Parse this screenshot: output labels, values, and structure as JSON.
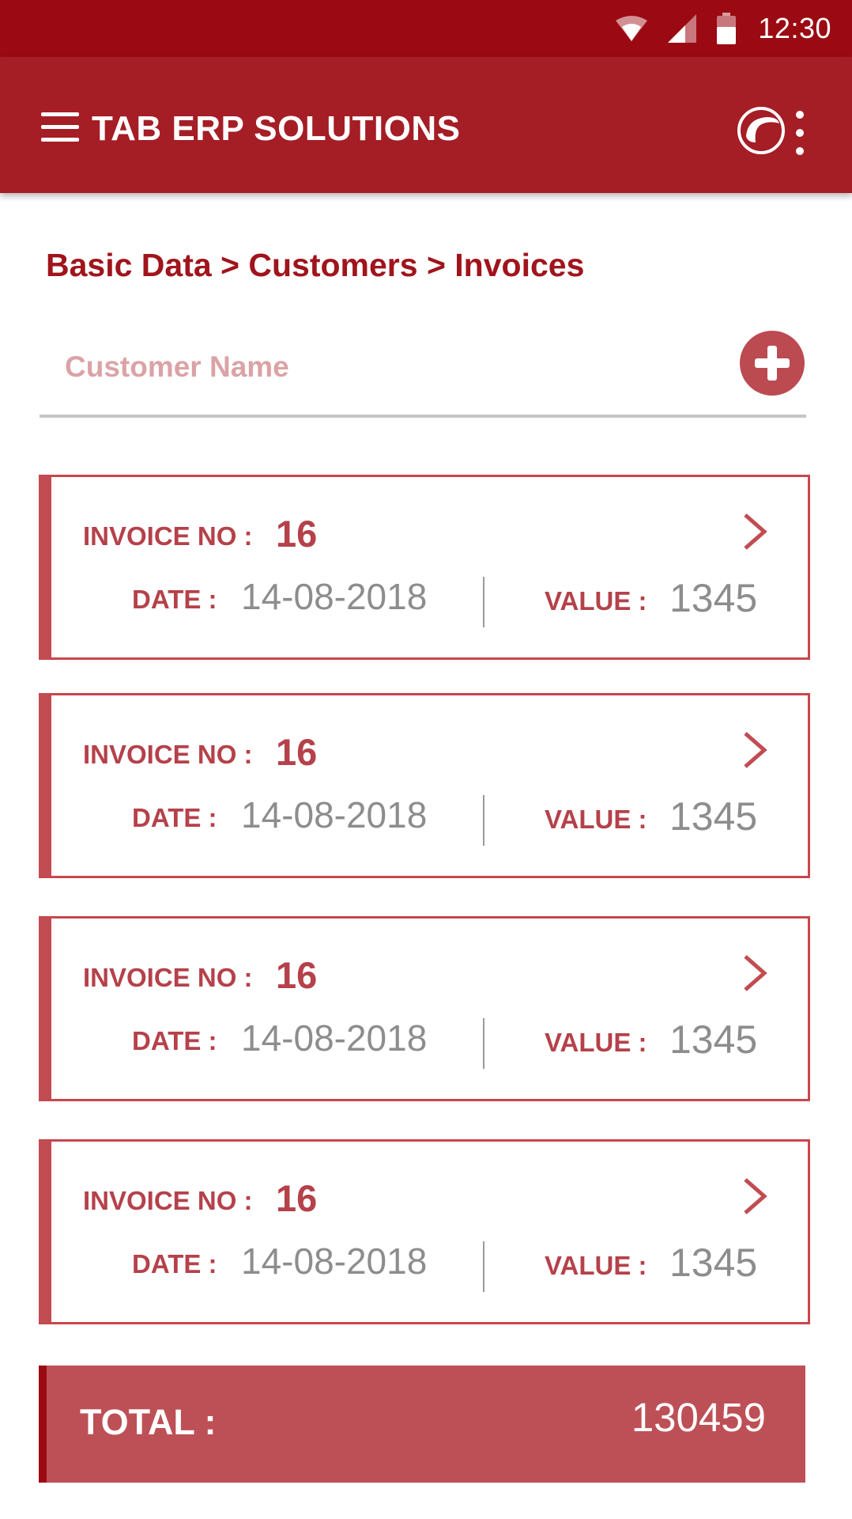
{
  "status_bar": {
    "time": "12:30",
    "icons": [
      "wifi-icon",
      "signal-icon",
      "battery-icon"
    ]
  },
  "app_bar": {
    "title": "TAB ERP SOLUTIONS",
    "icons": [
      "menu-icon",
      "logo-icon",
      "more-vert-icon"
    ]
  },
  "breadcrumb": "Basic Data > Customers > Invoices",
  "search": {
    "value": "",
    "placeholder": "Customer Name"
  },
  "invoices": [
    {
      "invoice_label": "INVOICE NO :",
      "invoice_no": "16",
      "date_label": "DATE :",
      "date": "14-08-2018",
      "value_label": "VALUE :",
      "value": "1345"
    },
    {
      "invoice_label": "INVOICE NO :",
      "invoice_no": "16",
      "date_label": "DATE :",
      "date": "14-08-2018",
      "value_label": "VALUE :",
      "value": "1345"
    },
    {
      "invoice_label": "INVOICE NO :",
      "invoice_no": "16",
      "date_label": "DATE :",
      "date": "14-08-2018",
      "value_label": "VALUE :",
      "value": "1345"
    },
    {
      "invoice_label": "INVOICE NO :",
      "invoice_no": "16",
      "date_label": "DATE :",
      "date": "14-08-2018",
      "value_label": "VALUE :",
      "value": "1345"
    }
  ],
  "total": {
    "label": "TOTAL :",
    "value": "130459"
  },
  "colors": {
    "status_bar": "#9b0a12",
    "app_bar": "#a51d25",
    "accent": "#b5414a",
    "total_bar": "#bd5056"
  }
}
